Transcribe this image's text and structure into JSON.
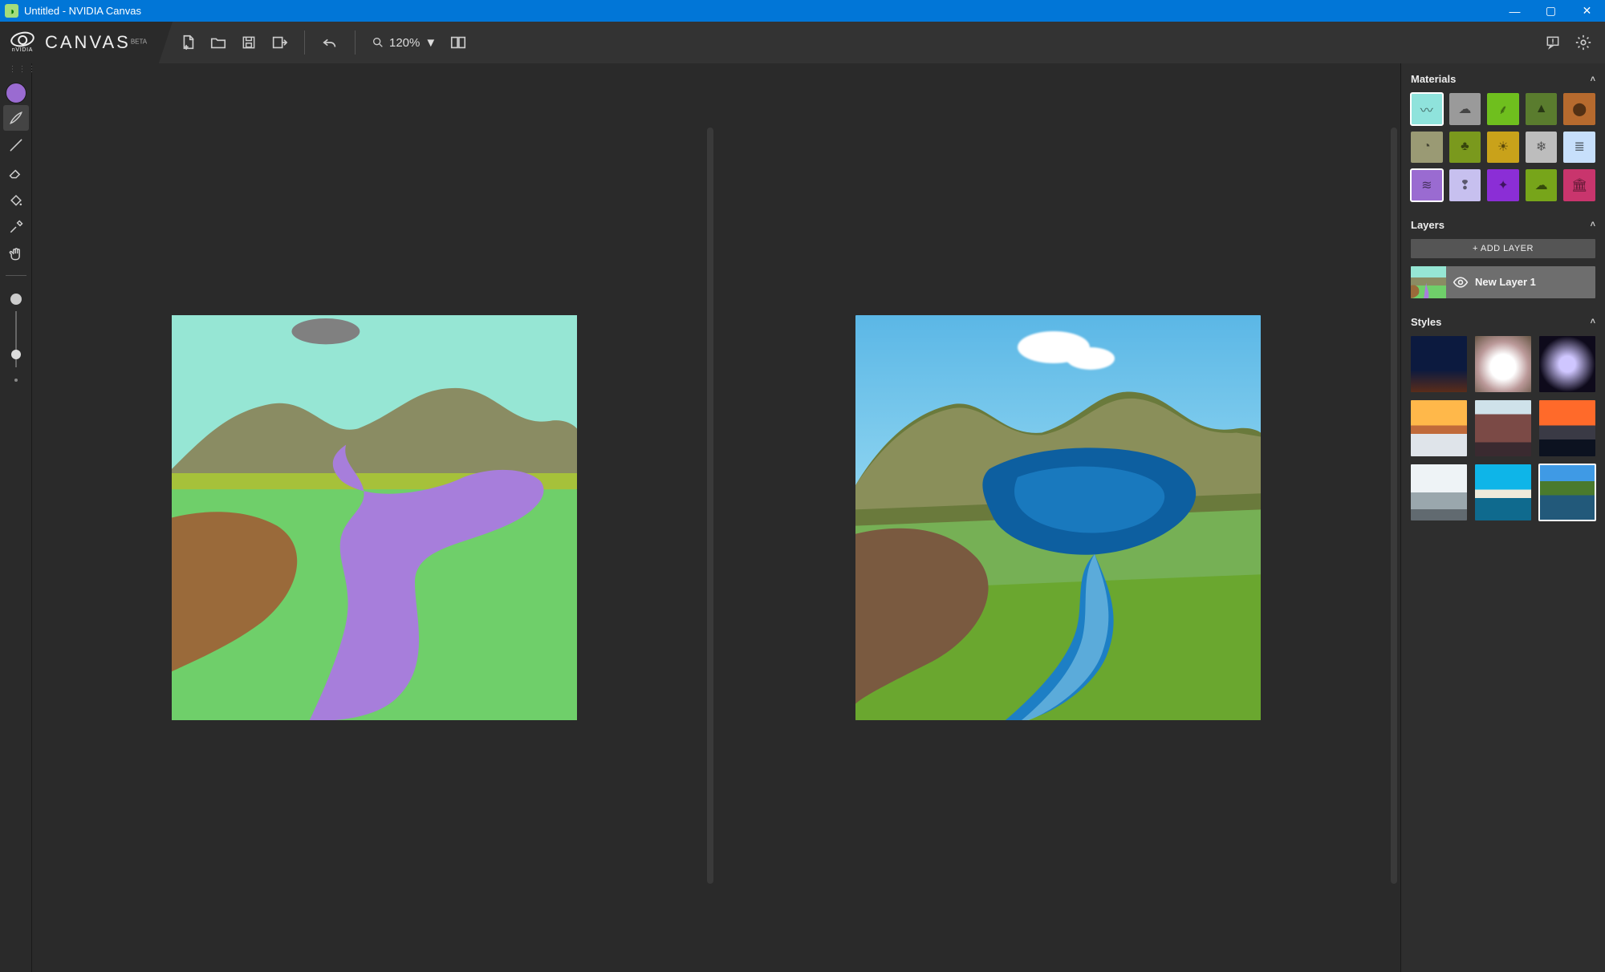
{
  "window": {
    "title": "Untitled - NVIDIA Canvas"
  },
  "brand": {
    "name": "CANVAS",
    "badge": "BETA",
    "logo_text": "nVIDIA"
  },
  "toolbar": {
    "zoom": "120%"
  },
  "tools": [
    {
      "name": "drag-handle",
      "interact": false
    },
    {
      "name": "color-swatch",
      "interact": true
    },
    {
      "name": "brush-tool",
      "interact": true,
      "active": true
    },
    {
      "name": "line-tool",
      "interact": true
    },
    {
      "name": "eraser-tool",
      "interact": true
    },
    {
      "name": "fill-tool",
      "interact": true
    },
    {
      "name": "eyedropper-tool",
      "interact": true
    },
    {
      "name": "pan-tool",
      "interact": true
    }
  ],
  "panels": {
    "materials_title": "Materials",
    "layers_title": "Layers",
    "styles_title": "Styles",
    "add_layer_label": "+ ADD LAYER",
    "layer_name": "New Layer 1"
  },
  "materials": [
    {
      "name": "sky",
      "color": "#8fe3dc",
      "selectedRow1": true
    },
    {
      "name": "cloud",
      "color": "#9a9a9a"
    },
    {
      "name": "grass",
      "color": "#6fbf1e"
    },
    {
      "name": "mountain",
      "color": "#5a7c2e"
    },
    {
      "name": "dirt",
      "color": "#b66a2e"
    },
    {
      "name": "hill",
      "color": "#9a9a74"
    },
    {
      "name": "tree",
      "color": "#7a991d"
    },
    {
      "name": "sand",
      "color": "#c9a21a"
    },
    {
      "name": "snow",
      "color": "#bdbdbd"
    },
    {
      "name": "fog",
      "color": "#c7dffb"
    },
    {
      "name": "water",
      "color": "#9a6bd1",
      "selected": true
    },
    {
      "name": "rain",
      "color": "#c7c0ef"
    },
    {
      "name": "stars",
      "color": "#8b2ed6"
    },
    {
      "name": "bush",
      "color": "#77a51a"
    },
    {
      "name": "building",
      "color": "#c9356d"
    }
  ],
  "styles": [
    {
      "name": "style-night-desert"
    },
    {
      "name": "style-cloud-burst"
    },
    {
      "name": "style-milky-arch"
    },
    {
      "name": "style-sunset-clouds"
    },
    {
      "name": "style-red-rocks"
    },
    {
      "name": "style-ocean-sunset"
    },
    {
      "name": "style-fog-mountain"
    },
    {
      "name": "style-tropical-beach"
    },
    {
      "name": "style-alpine-lake",
      "selected": true
    }
  ]
}
